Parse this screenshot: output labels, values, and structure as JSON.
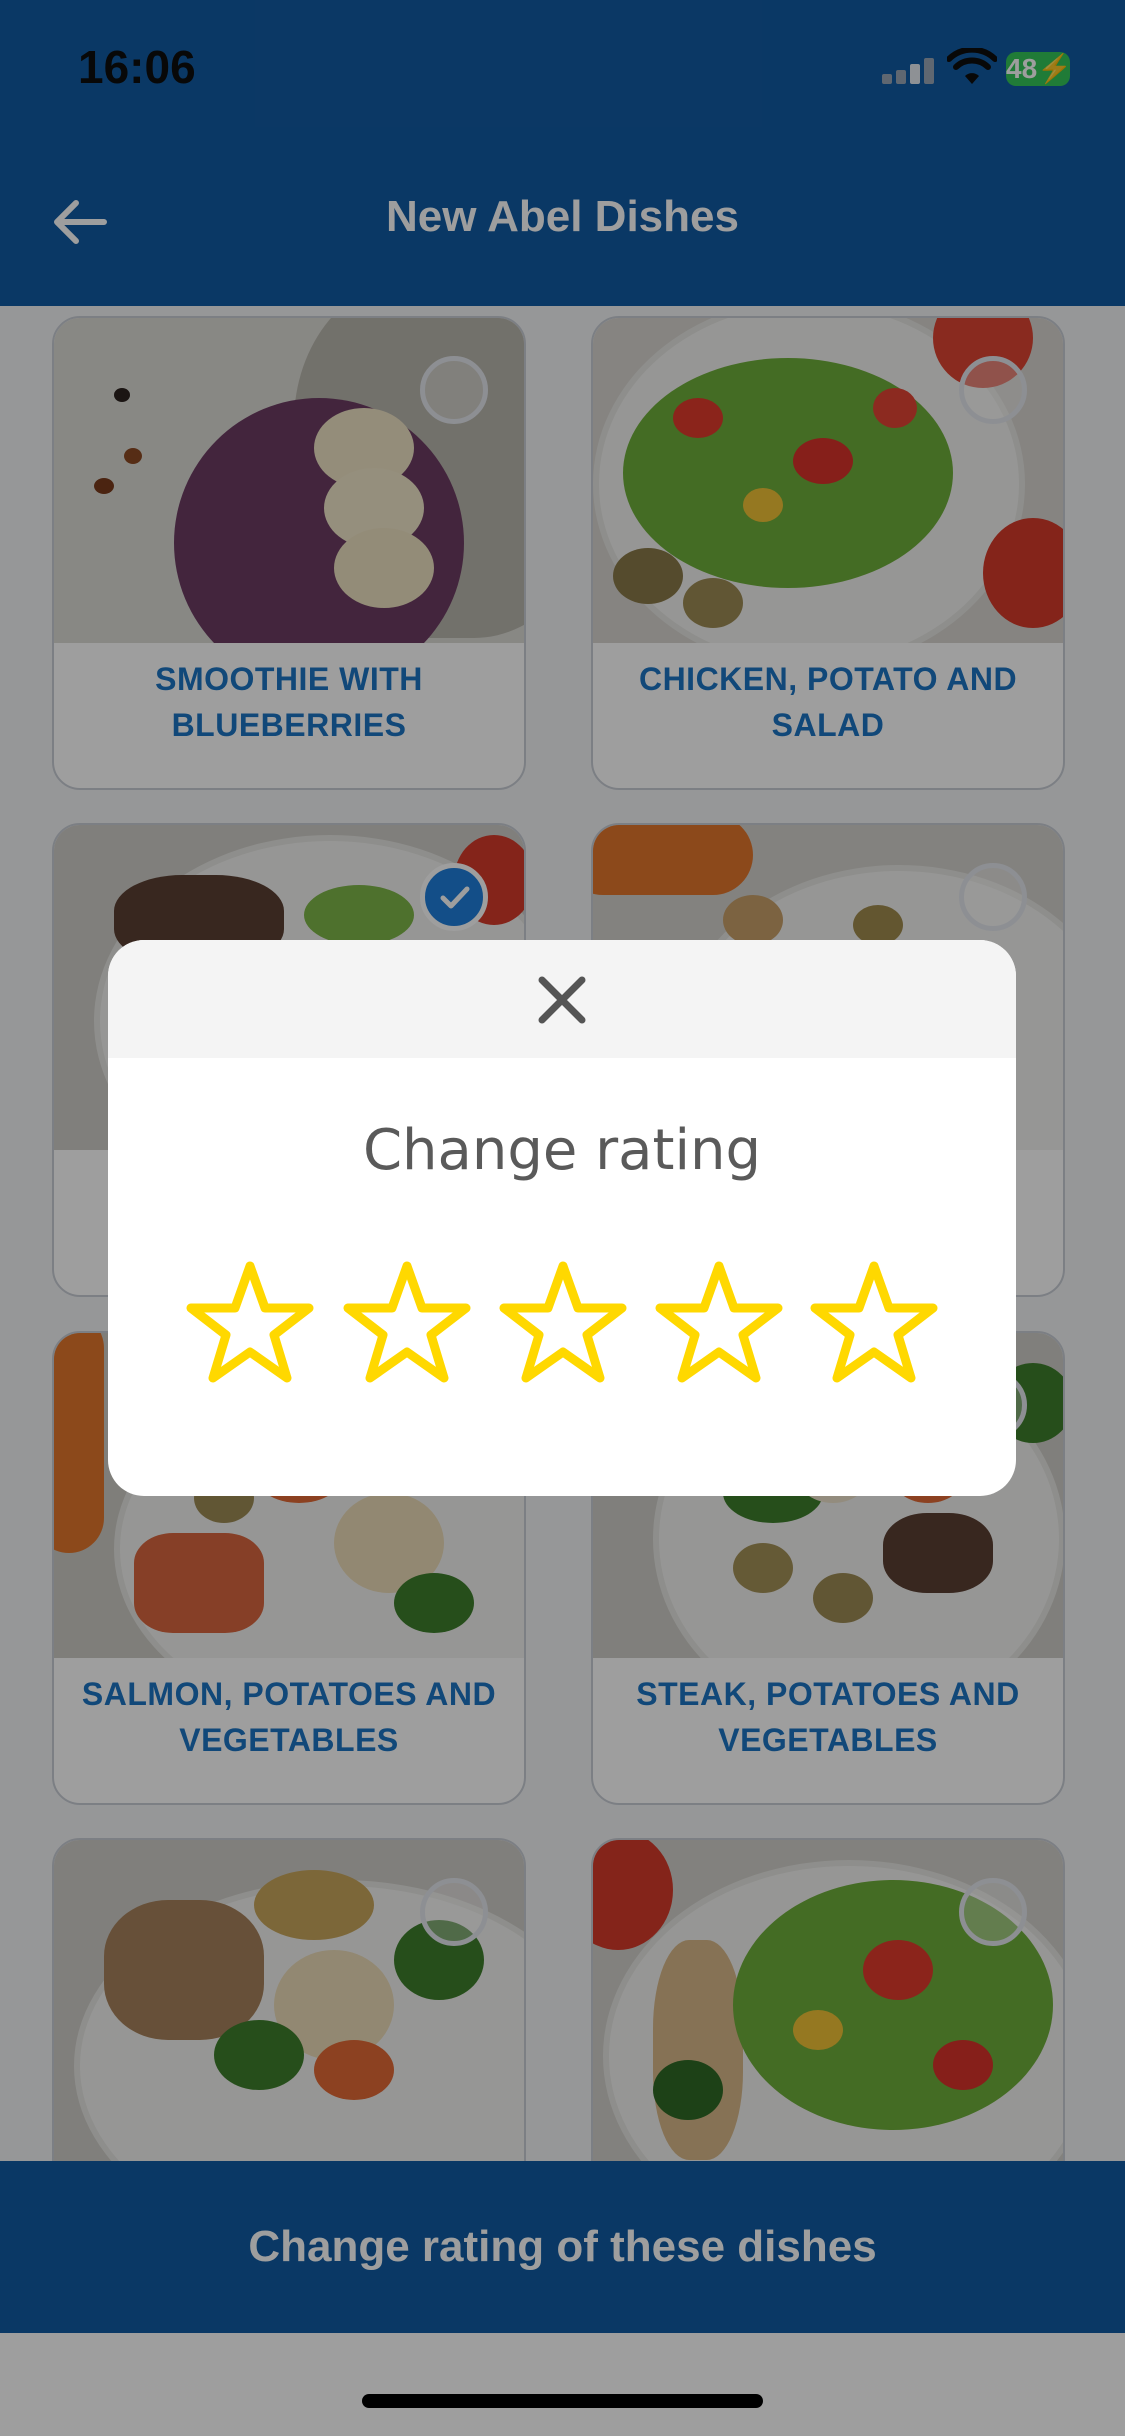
{
  "status": {
    "time": "16:06",
    "battery": "48"
  },
  "header": {
    "title": "New Abel Dishes"
  },
  "dishes": [
    {
      "label": "SMOOTHIE WITH BLUEBERRIES",
      "selected": false
    },
    {
      "label": "CHICKEN, POTATO AND SALAD",
      "selected": false
    },
    {
      "label": "",
      "selected": true
    },
    {
      "label": "",
      "selected": false
    },
    {
      "label": "SALMON, POTATOES AND VEGETABLES",
      "selected": false
    },
    {
      "label": "STEAK, POTATOES AND VEGETABLES",
      "selected": false
    },
    {
      "label": "",
      "selected": false
    },
    {
      "label": "",
      "selected": false
    }
  ],
  "modal": {
    "title": "Change rating",
    "rating": 0,
    "max_rating": 5
  },
  "footer": {
    "action_label": "Change rating of these dishes"
  },
  "colors": {
    "brand": "#115ba3",
    "accent": "#1c75c4",
    "star": "#ffd800"
  }
}
